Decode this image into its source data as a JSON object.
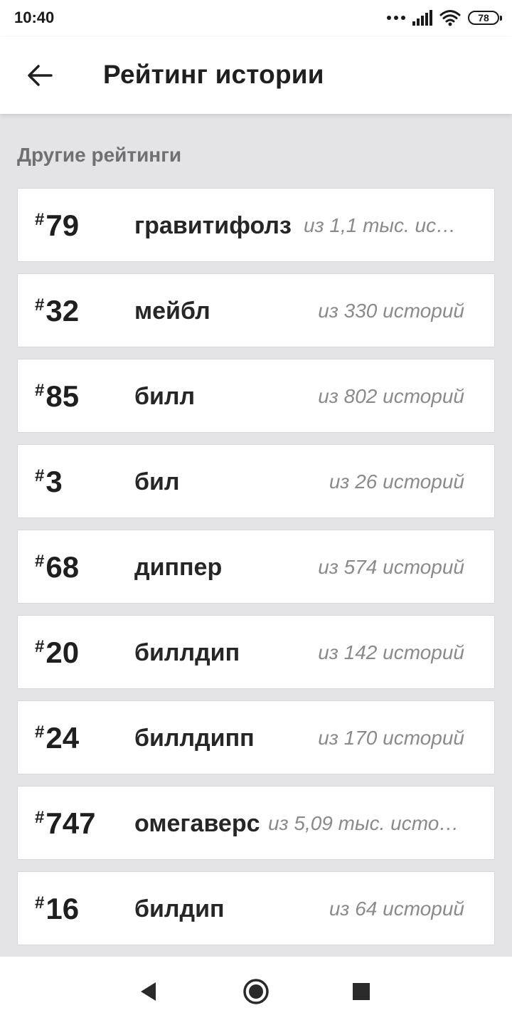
{
  "status_bar": {
    "time": "10:40",
    "battery": "78"
  },
  "header": {
    "title": "Рейтинг истории"
  },
  "section": {
    "title": "Другие рейтинги"
  },
  "rankings": [
    {
      "hash": "#",
      "rank": "79",
      "tag": "гравитифолз",
      "count": "из 1,1 тыс. ист..."
    },
    {
      "hash": "#",
      "rank": "32",
      "tag": "мейбл",
      "count": "из 330 историй"
    },
    {
      "hash": "#",
      "rank": "85",
      "tag": "билл",
      "count": "из 802 историй"
    },
    {
      "hash": "#",
      "rank": "3",
      "tag": "бил",
      "count": "из 26 историй"
    },
    {
      "hash": "#",
      "rank": "68",
      "tag": "диппер",
      "count": "из 574 историй"
    },
    {
      "hash": "#",
      "rank": "20",
      "tag": "биллдип",
      "count": "из 142 историй"
    },
    {
      "hash": "#",
      "rank": "24",
      "tag": "биллдипп",
      "count": "из 170 историй"
    },
    {
      "hash": "#",
      "rank": "747",
      "tag": "омегаверс",
      "count": "из 5,09 тыс. истор..."
    },
    {
      "hash": "#",
      "rank": "16",
      "tag": "билдип",
      "count": "из 64 историй"
    }
  ],
  "icons": {
    "back": "arrow-left-icon",
    "nav_back": "triangle-back-icon",
    "nav_home": "circle-home-icon",
    "nav_recents": "square-recents-icon"
  },
  "colors": {
    "background": "#e4e3e6",
    "card": "#ffffff",
    "text_primary": "#1f1f1f",
    "text_secondary": "#8a8a8a",
    "section_title": "#707070"
  }
}
